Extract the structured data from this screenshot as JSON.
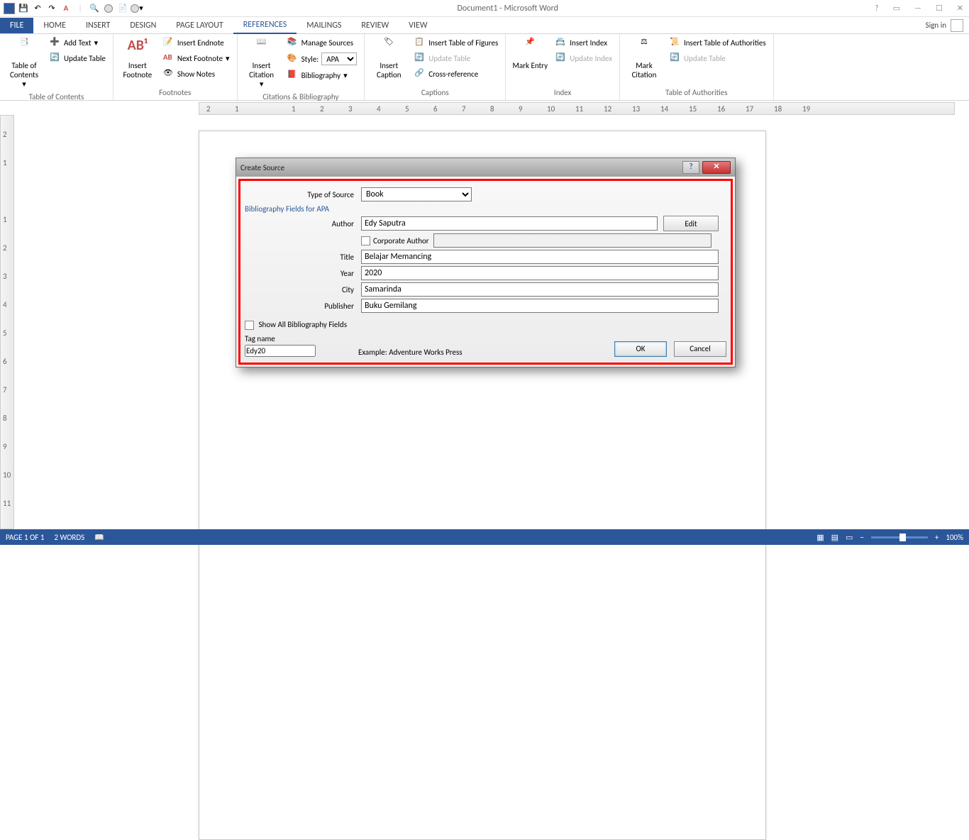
{
  "titlebar": {
    "title": "Document1 - Microsoft Word"
  },
  "tabs": {
    "file": "FILE",
    "home": "HOME",
    "insert": "INSERT",
    "design": "DESIGN",
    "pageLayout": "PAGE LAYOUT",
    "references": "REFERENCES",
    "mailings": "MAILINGS",
    "review": "REVIEW",
    "view": "VIEW"
  },
  "signin": "Sign in",
  "ribbon": {
    "toc": {
      "btn": "Table of Contents",
      "add": "Add Text",
      "update": "Update Table",
      "group": "Table of Contents"
    },
    "fn": {
      "btn": "Insert Footnote",
      "endnote": "Insert Endnote",
      "next": "Next Footnote",
      "show": "Show Notes",
      "group": "Footnotes"
    },
    "cit": {
      "btn": "Insert Citation",
      "manage": "Manage Sources",
      "style": "Style:",
      "styleVal": "APA",
      "bib": "Bibliography",
      "group": "Citations & Bibliography"
    },
    "cap": {
      "btn": "Insert Caption",
      "tof": "Insert Table of Figures",
      "update": "Update Table",
      "cross": "Cross-reference",
      "group": "Captions"
    },
    "idx": {
      "btn": "Mark Entry",
      "insert": "Insert Index",
      "update": "Update Index",
      "group": "Index"
    },
    "toa": {
      "btn": "Mark Citation",
      "insert": "Insert Table of Authorities",
      "update": "Update Table",
      "group": "Table of Authorities"
    }
  },
  "dialog": {
    "title": "Create Source",
    "typeLabel": "Type of Source",
    "typeVal": "Book",
    "section": "Bibliography Fields for APA",
    "fields": {
      "author": {
        "label": "Author",
        "val": "Edy Saputra",
        "edit": "Edit"
      },
      "corp": "Corporate Author",
      "title": {
        "label": "Title",
        "val": "Belajar Memancing"
      },
      "year": {
        "label": "Year",
        "val": "2020"
      },
      "city": {
        "label": "City",
        "val": "Samarinda"
      },
      "publisher": {
        "label": "Publisher",
        "val": "Buku Gemilang"
      }
    },
    "showAll": "Show All Bibliography Fields",
    "tagLabel": "Tag name",
    "tagVal": "Edy20",
    "example": "Example: Adventure Works Press",
    "ok": "OK",
    "cancel": "Cancel"
  },
  "status": {
    "page": "PAGE 1 OF 1",
    "words": "2 WORDS",
    "zoom": "100%"
  }
}
